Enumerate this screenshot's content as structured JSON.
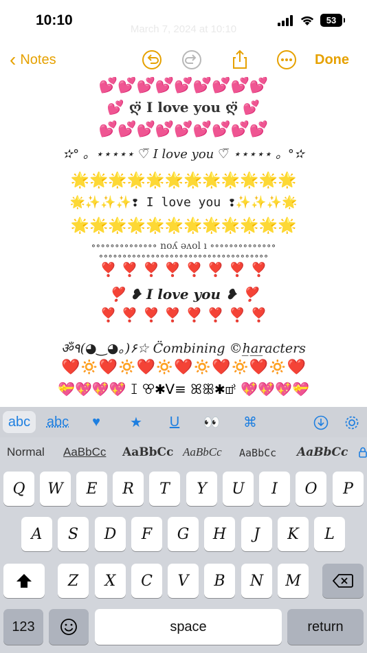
{
  "status": {
    "time": "10:10",
    "battery": "53"
  },
  "nav": {
    "back_label": "Notes",
    "done_label": "Done",
    "ghost_date": "March 7, 2024 at 10:10"
  },
  "note": {
    "lines": [
      "💕💕💕💕💕💕💕💕💕",
      "💕   ღ̈ I love you ღ̈   💕",
      "💕💕💕💕💕💕💕💕💕",
      "✫° 。⋆⋆⋆⋆⋆ ♡̅ I love you ♡̅ ⋆⋆⋆⋆⋆ 。°✫",
      "🌟🌟🌟🌟🌟🌟🌟🌟🌟🌟🌟🌟",
      "🌟✨✨✨❢ I love you ❢✨✨✨🌟",
      "🌟🌟🌟🌟🌟🌟🌟🌟🌟🌟🌟🌟",
      "∘∘∘∘∘∘∘∘∘∘∘∘∘∘    noʎ ǝʌol ı    ∘∘∘∘∘∘∘∘∘∘∘∘∘∘",
      "∘∘∘∘∘∘∘∘∘∘∘∘∘∘∘∘∘∘∘∘∘∘∘∘∘∘∘∘∘∘∘∘∘∘∘∘",
      "❣️ ❣️ ❣️ ❣️ ❣️ ❣️ ❣️ ❣️",
      "❣️   ❥ I love you ❥   ❣️",
      "❣️ ❣️ ❣️ ❣️ ❣️ ❣️ ❣️ ❣️",
      "ॐ٩(◕‿◕｡)۶☆ C̈ombining ©h̲a̲r̲acters",
      "❤️🔅❤️🔅❤️🔅❤️🔅❤️🔅❤️🔅❤️",
      "💝💖💖💖 ꕯ ꕢ✱ᐯ≡ ꕤꕥ✱ꕡ 💖💖💖💝"
    ]
  },
  "keyboard": {
    "toolbar": [
      "abc",
      "abc",
      "♥",
      "★",
      "U",
      "👀",
      "⌘"
    ],
    "fonts": [
      "Normal",
      "AaBbCc",
      "AaBbCc",
      "AaBbCc",
      "AaBbCc",
      "AaBbCc"
    ],
    "row1": [
      "Q",
      "W",
      "E",
      "R",
      "T",
      "Y",
      "U",
      "I",
      "O",
      "P"
    ],
    "row2": [
      "A",
      "S",
      "D",
      "F",
      "G",
      "H",
      "J",
      "K",
      "L"
    ],
    "row3": [
      "Z",
      "X",
      "C",
      "V",
      "B",
      "N",
      "M"
    ],
    "numbers_label": "123",
    "space_label": "space",
    "return_label": "return"
  },
  "colors": {
    "accent": "#e6a100",
    "keyboard_bg": "#d2d5db",
    "link_blue": "#1e7fe0"
  }
}
